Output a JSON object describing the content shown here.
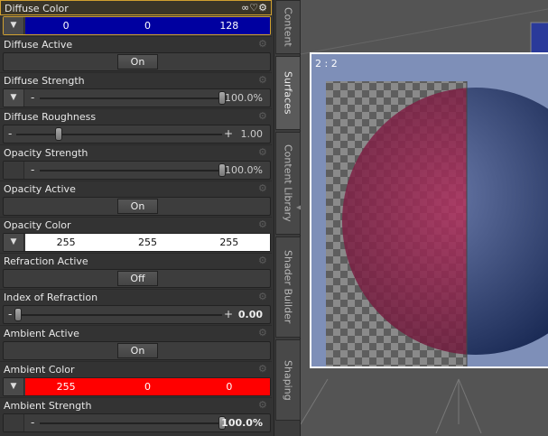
{
  "colors": {
    "diffuse_bg": "#0000a0",
    "opacity_bg": "#ffffff",
    "ambient_bg": "#ff0000",
    "highlight": "#d0a030"
  },
  "props": [
    {
      "name": "Diffuse Color",
      "kind": "color",
      "values": [
        "0",
        "0",
        "128"
      ]
    },
    {
      "name": "Diffuse Active",
      "kind": "toggle",
      "value": "On"
    },
    {
      "name": "Diffuse Strength",
      "kind": "slider",
      "value": "100.0%",
      "level": 1.0
    },
    {
      "name": "Diffuse Roughness",
      "kind": "slider",
      "value": "1.00",
      "level": 1.0
    },
    {
      "name": "Opacity Strength",
      "kind": "slider",
      "value": "100.0%",
      "level": 1.0
    },
    {
      "name": "Opacity Active",
      "kind": "toggle",
      "value": "On"
    },
    {
      "name": "Opacity Color",
      "kind": "color",
      "values": [
        "255",
        "255",
        "255"
      ]
    },
    {
      "name": "Refraction Active",
      "kind": "toggle",
      "value": "Off"
    },
    {
      "name": "Index of Refraction",
      "kind": "slider",
      "value": "0.00",
      "level": 0.0
    },
    {
      "name": "Ambient Active",
      "kind": "toggle",
      "value": "On"
    },
    {
      "name": "Ambient Color",
      "kind": "color",
      "values": [
        "255",
        "0",
        "0"
      ]
    },
    {
      "name": "Ambient Strength",
      "kind": "slider",
      "value": "100.0%",
      "level": 1.0
    }
  ],
  "tabs": [
    "Content",
    "Surfaces",
    "Content Library",
    "Shader Builder",
    "Shaping"
  ],
  "viewport": {
    "label": "2 : 2"
  }
}
